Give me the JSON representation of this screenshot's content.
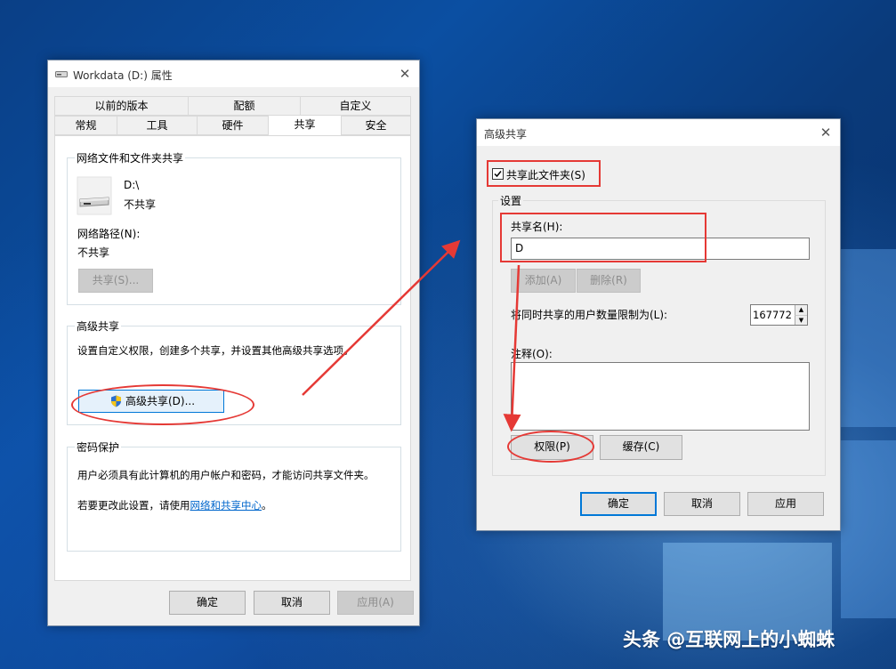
{
  "props_window": {
    "title": "Workdata (D:) 属性",
    "tabs_row1": [
      "以前的版本",
      "配额",
      "自定义"
    ],
    "tabs_row2": [
      "常规",
      "工具",
      "硬件",
      "共享",
      "安全"
    ],
    "network_group": {
      "legend": "网络文件和文件夹共享",
      "drive": "D:\\",
      "status": "不共享",
      "path_label": "网络路径(N):",
      "path_value": "不共享",
      "share_button": "共享(S)..."
    },
    "advanced_group": {
      "legend": "高级共享",
      "description": "设置自定义权限，创建多个共享，并设置其他高级共享选项。",
      "button": "高级共享(D)..."
    },
    "password_group": {
      "legend": "密码保护",
      "line1": "用户必须具有此计算机的用户帐户和密码，才能访问共享文件夹。",
      "line2_prefix": "若要更改此设置，请使用",
      "line2_link": "网络和共享中心",
      "line2_suffix": "。"
    },
    "buttons": {
      "ok": "确定",
      "cancel": "取消",
      "apply": "应用(A)"
    }
  },
  "adv_window": {
    "title": "高级共享",
    "share_checkbox_label": "共享此文件夹(S)",
    "share_checked": true,
    "settings_legend": "设置",
    "share_name_label": "共享名(H):",
    "share_name_value": "D",
    "add_button": "添加(A)",
    "remove_button": "删除(R)",
    "user_limit_label": "将同时共享的用户数量限制为(L):",
    "user_limit_value": "167772",
    "comment_label": "注释(O):",
    "permissions_button": "权限(P)",
    "cache_button": "缓存(C)",
    "buttons": {
      "ok": "确定",
      "cancel": "取消",
      "apply": "应用"
    }
  },
  "watermark": "头条 @互联网上的小蜘蛛",
  "colors": {
    "annotation_red": "#e53935",
    "link_blue": "#0066cc",
    "focus_blue": "#0078d7"
  }
}
